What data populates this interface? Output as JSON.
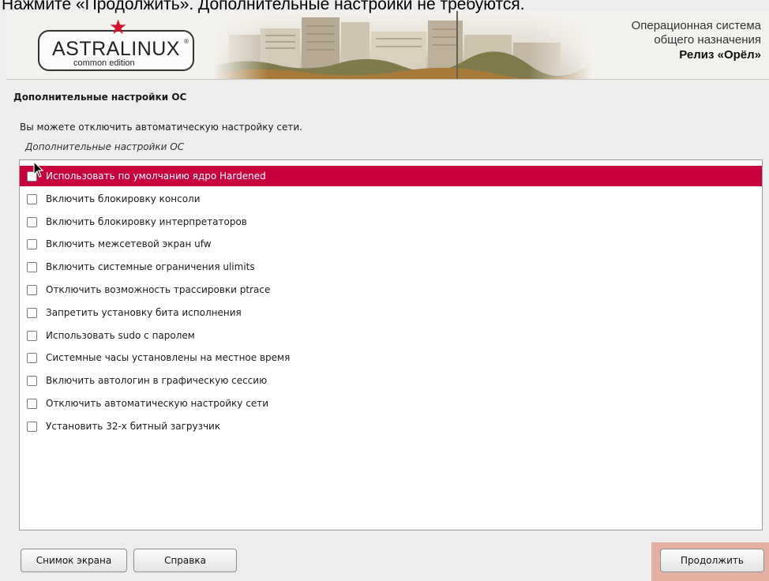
{
  "caption": "Нажмите «Продолжить». Дополнительные настройки не требуются.",
  "header": {
    "logo_main": "ASTRALINUX",
    "logo_registered": "®",
    "logo_sub": "common edition",
    "title_line1": "Операционная система",
    "title_line2": "общего назначения",
    "release": "Релиз «Орёл»"
  },
  "section_title": "Дополнительные настройки ОС",
  "description": "Вы можете отключить автоматическую настройку сети.",
  "list_label": "Дополнительные настройки ОС",
  "options": [
    {
      "label": "Использовать по умолчанию ядро Hardened",
      "checked": false,
      "selected": true
    },
    {
      "label": "Включить блокировку консоли",
      "checked": false
    },
    {
      "label": "Включить блокировку интерпретаторов",
      "checked": false
    },
    {
      "label": "Включить межсетевой экран ufw",
      "checked": false
    },
    {
      "label": "Включить системные ограничения ulimits",
      "checked": false
    },
    {
      "label": "Отключить возможность трассировки ptrace",
      "checked": false
    },
    {
      "label": "Запретить установку бита исполнения",
      "checked": false
    },
    {
      "label": "Использовать sudo с паролем",
      "checked": false
    },
    {
      "label": "Системные часы установлены на местное время",
      "checked": false
    },
    {
      "label": "Включить автологин в графическую сессию",
      "checked": false
    },
    {
      "label": "Отключить автоматическую настройку сети",
      "checked": false
    },
    {
      "label": "Установить 32-х битный загрузчик",
      "checked": false
    }
  ],
  "buttons": {
    "screenshot": "Снимок экрана",
    "help": "Справка",
    "continue": "Продолжить"
  },
  "colors": {
    "selection": "#c8003e",
    "logo_star": "#d8112a",
    "continue_highlight": "#e4b0a2"
  }
}
